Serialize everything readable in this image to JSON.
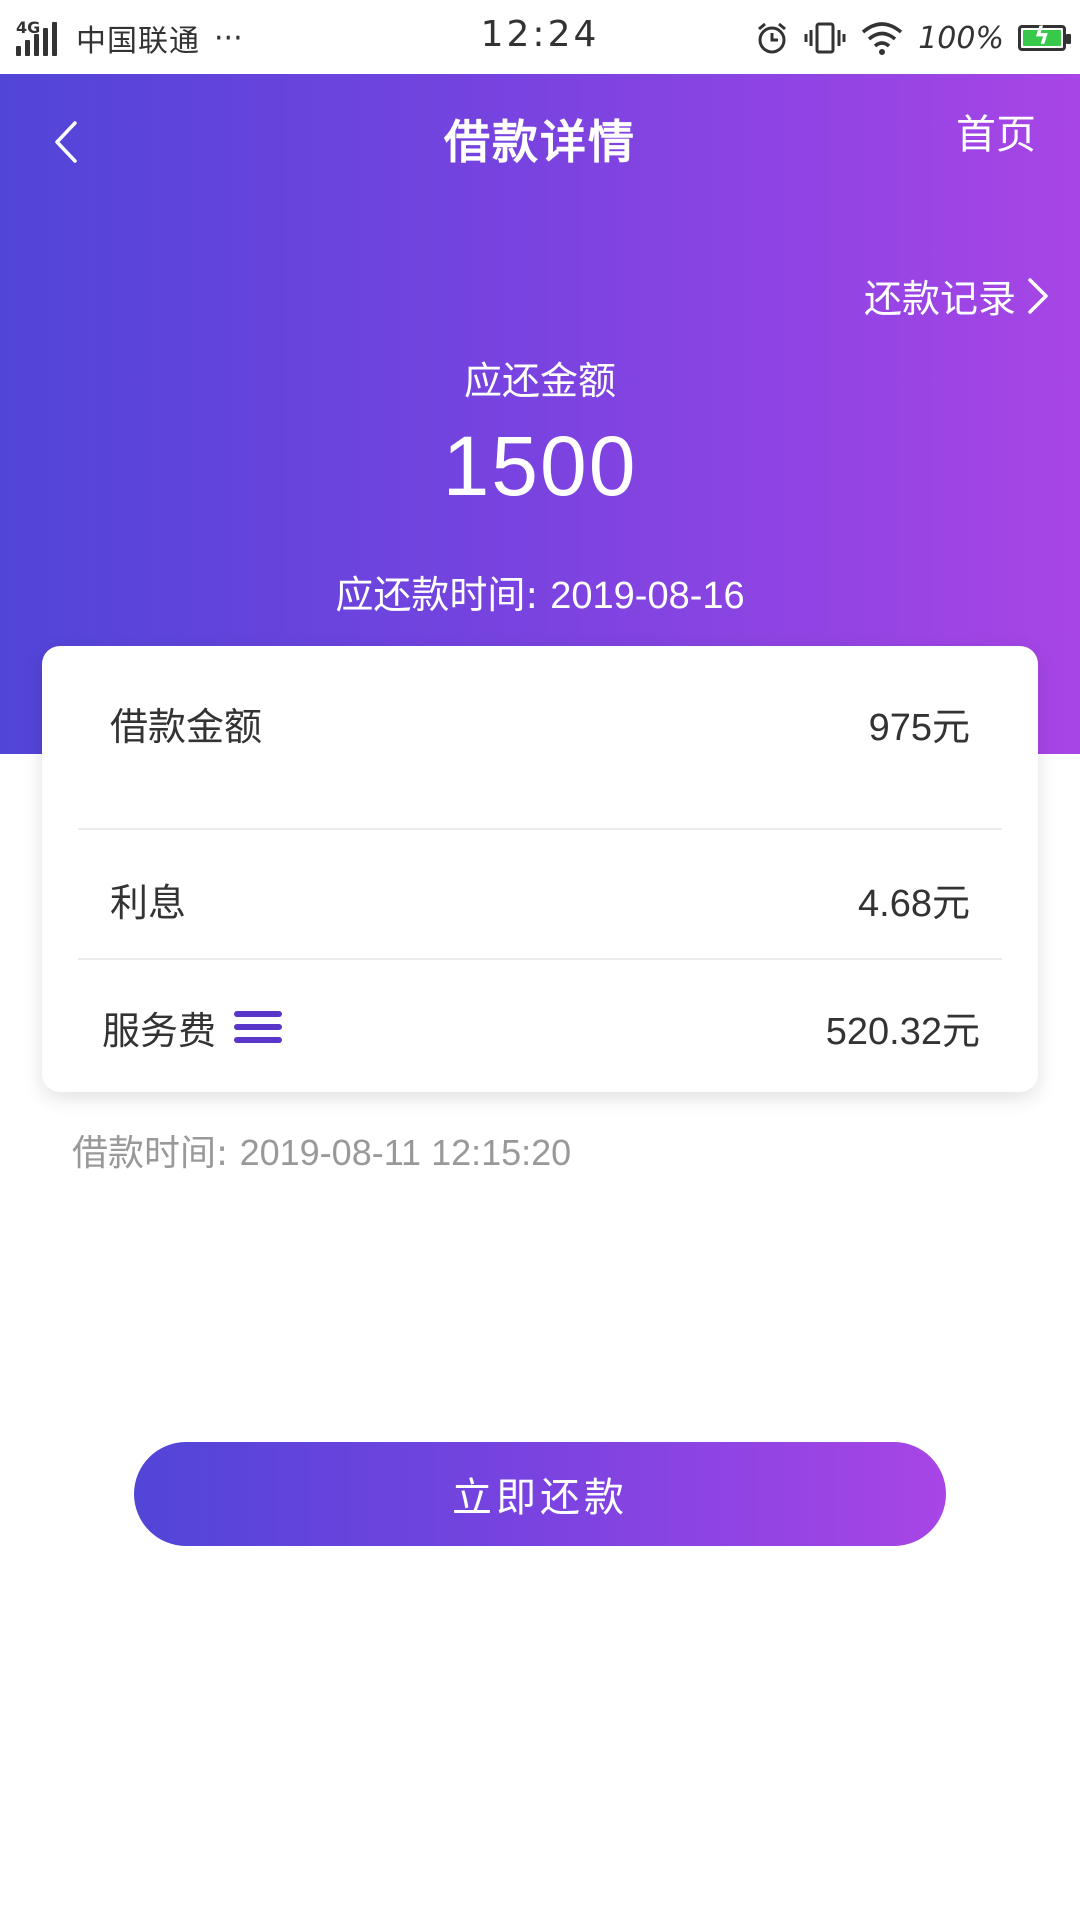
{
  "status_bar": {
    "network": "4G",
    "carrier": "中国联通",
    "more": "···",
    "time": "12:24",
    "battery_percent": "100%"
  },
  "header": {
    "title": "借款详情",
    "home_label": "首页",
    "records_label": "还款记录",
    "due_label": "应还金额",
    "due_amount": "1500",
    "due_date_label": "应还款时间:",
    "due_date": "2019-08-16",
    "gradient_colors": [
      "#5145d8",
      "#a845e6"
    ]
  },
  "details": {
    "rows": [
      {
        "label": "借款金额",
        "amount": "975",
        "unit": "元"
      },
      {
        "label": "利息",
        "amount": "4.68",
        "unit": "元"
      },
      {
        "label": "服务费",
        "amount": "520.32",
        "unit": "元"
      }
    ]
  },
  "loan_time": {
    "label": "借款时间:",
    "value": "2019-08-11 12:15:20"
  },
  "actions": {
    "repay_label": "立即还款"
  }
}
